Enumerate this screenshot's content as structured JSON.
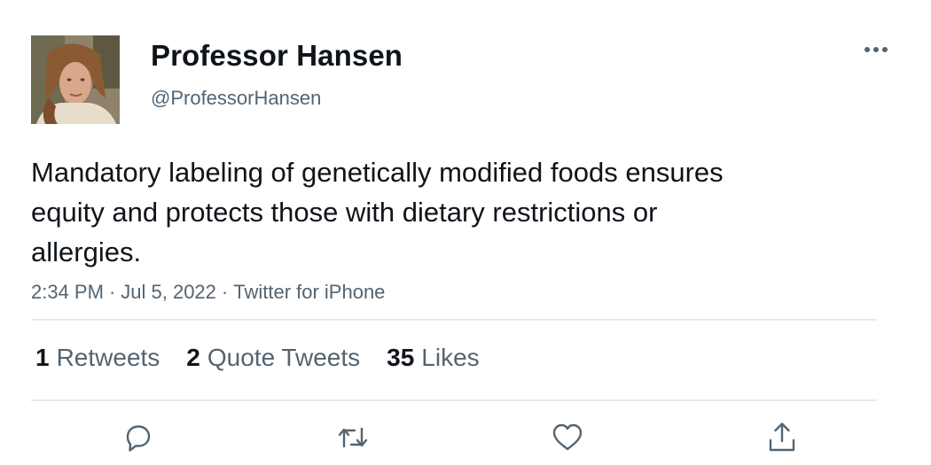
{
  "author": {
    "display_name": "Professor Hansen",
    "handle": "@ProfessorHansen",
    "avatar_icon": "profile-photo"
  },
  "more_icon": "ellipsis-icon",
  "tweet": {
    "text": "Mandatory labeling of genetically modified foods ensures equity and protects those with dietary restrictions or allergies.",
    "time": "2:34 PM",
    "date": "Jul 5, 2022",
    "source": "Twitter for iPhone",
    "separator": "·"
  },
  "stats": {
    "retweets_count": "1",
    "retweets_label": "Retweets",
    "quotes_count": "2",
    "quotes_label": "Quote Tweets",
    "likes_count": "35",
    "likes_label": "Likes"
  },
  "actions": [
    "reply-icon",
    "retweet-icon",
    "like-icon",
    "share-icon"
  ],
  "colors": {
    "text": "#0f1419",
    "secondary": "#536471",
    "divider": "#e6e9eb"
  }
}
